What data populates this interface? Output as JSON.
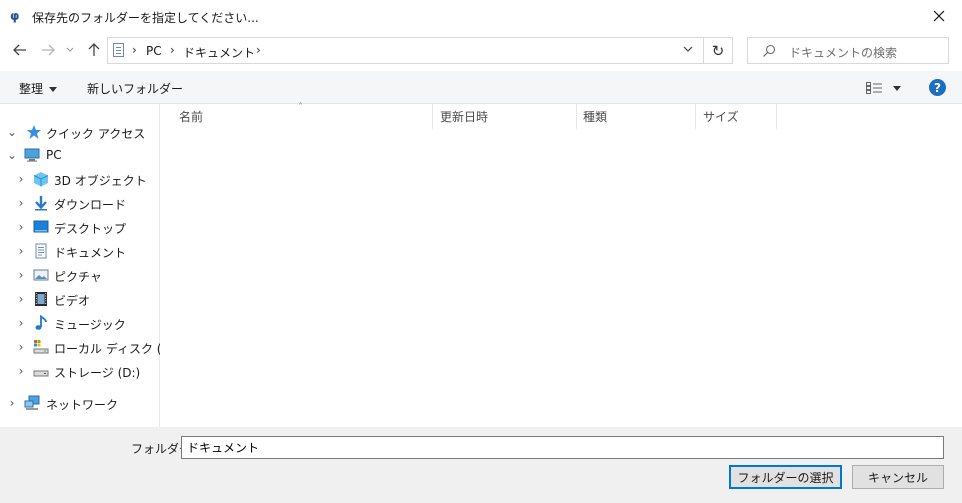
{
  "window": {
    "title": "保存先のフォルダーを指定してください..."
  },
  "address": {
    "crumbs": [
      "PC",
      "ドキュメント"
    ]
  },
  "search": {
    "placeholder": "ドキュメントの検索"
  },
  "commandbar": {
    "organize_label": "整理",
    "new_folder_label": "新しいフォルダー"
  },
  "nav": {
    "quick_access": "クイック アクセス",
    "pc": "PC",
    "items": [
      {
        "label": "3D オブジェクト",
        "icon": "3d-objects-icon"
      },
      {
        "label": "ダウンロード",
        "icon": "downloads-icon"
      },
      {
        "label": "デスクトップ",
        "icon": "desktop-icon"
      },
      {
        "label": "ドキュメント",
        "icon": "documents-icon"
      },
      {
        "label": "ピクチャ",
        "icon": "pictures-icon"
      },
      {
        "label": "ビデオ",
        "icon": "videos-icon"
      },
      {
        "label": "ミュージック",
        "icon": "music-icon"
      },
      {
        "label": "ローカル ディスク (C:)",
        "icon": "local-disk-icon"
      },
      {
        "label": "ストレージ (D:)",
        "icon": "drive-icon"
      }
    ],
    "network": "ネットワーク"
  },
  "columns": [
    "名前",
    "更新日時",
    "種類",
    "サイズ"
  ],
  "footer": {
    "folder_label": "フォルダー:",
    "folder_value": "ドキュメント",
    "select_button": "フォルダーの選択",
    "cancel_button": "キャンセル"
  },
  "colors": {
    "accent": "#0078d7",
    "help": "#1b6ec2",
    "toolbar_bg": "#f5f6f7",
    "footer_bg": "#f0f0f0"
  }
}
